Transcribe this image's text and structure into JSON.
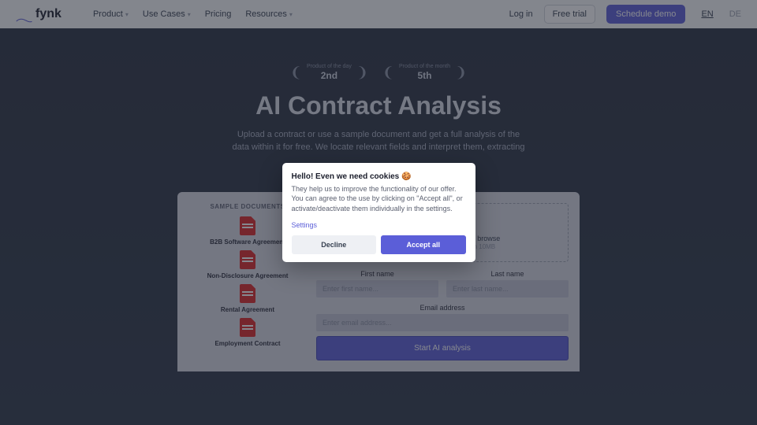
{
  "brand": "fynk",
  "nav": {
    "product": "Product",
    "useCases": "Use Cases",
    "pricing": "Pricing",
    "resources": "Resources"
  },
  "auth": {
    "login": "Log in",
    "trial": "Free trial",
    "demo": "Schedule demo"
  },
  "lang": {
    "en": "EN",
    "de": "DE"
  },
  "badges": {
    "day": {
      "label": "Product of the day",
      "rank": "2nd"
    },
    "month": {
      "label": "Product of the month",
      "rank": "5th"
    }
  },
  "hero": {
    "title": "AI Contract Analysis",
    "sub": "Upload a contract or use a sample document and get a full analysis of the data within it for free. We locate relevant fields and interpret them, extracting"
  },
  "samples": {
    "heading": "SAMPLE DOCUMENTS",
    "items": [
      "B2B Software Agreement",
      "Non-Disclosure Agreement",
      "Rental Agreement",
      "Employment Contract"
    ]
  },
  "drop": {
    "title": "Drop PDF file here or click to browse",
    "sub": "only one file allowed, maximum 10MB"
  },
  "form": {
    "first": "First name",
    "firstPh": "Enter first name...",
    "last": "Last name",
    "lastPh": "Enter last name...",
    "email": "Email address",
    "emailPh": "Enter email address...",
    "cta": "Start AI analysis"
  },
  "cookie": {
    "title": "Hello! Even we need cookies 🍪",
    "body": "They help us to improve the functionality of our offer. You can agree to the use by clicking on \"Accept all\", or activate/deactivate them individually in the settings.",
    "settings": "Settings",
    "decline": "Decline",
    "accept": "Accept all"
  }
}
